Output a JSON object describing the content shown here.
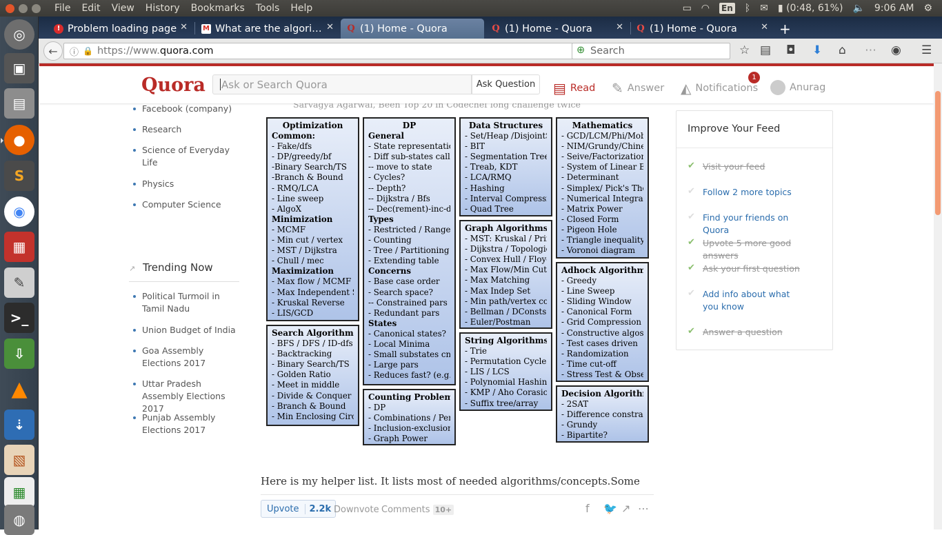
{
  "os_panel": {
    "menu": [
      "File",
      "Edit",
      "View",
      "History",
      "Bookmarks",
      "Tools",
      "Help"
    ],
    "keyboard": "En",
    "battery": "(0:48, 61%)",
    "time": "9:06 AM"
  },
  "tabs": [
    {
      "title": "Problem loading page",
      "icon": "error-icon"
    },
    {
      "title": "What are the algori…",
      "icon": "gmail-icon"
    },
    {
      "title": "(1) Home - Quora",
      "icon": "quora-icon"
    },
    {
      "title": "(1) Home - Quora",
      "icon": "quora-icon"
    },
    {
      "title": "(1) Home - Quora",
      "icon": "quora-icon"
    }
  ],
  "url": {
    "prefix": "https://www.",
    "domain": "quora.com"
  },
  "browser_search_placeholder": "Search",
  "quora": {
    "logo": "Quora",
    "search_placeholder": "Ask or Search Quora",
    "ask_button": "Ask Question",
    "nav": {
      "read": "Read",
      "answer": "Answer",
      "notifications": "Notifications",
      "notif_count": "1",
      "user": "Anurag"
    }
  },
  "sidebar": {
    "topics": [
      "Facebook (company)",
      "Research",
      "Science of Everyday Life",
      "Physics",
      "Computer Science"
    ],
    "trending_title": "Trending Now",
    "trending": [
      "Political Turmoil in Tamil Nadu",
      "Union Budget of India",
      "Goa Assembly Elections 2017",
      "Uttar Pradesh Assembly Elections 2017",
      "Punjab Assembly Elections 2017"
    ]
  },
  "answer": {
    "author_line": "Sarvagya Agarwal, Been Top 20 in Codechef long challenge twice",
    "helper_text": "Here is my helper list. It lists most of needed algorithms/concepts.Some",
    "upvote_label": "Upvote",
    "upvote_count": "2.2k",
    "downvote_label": "Downvote",
    "comments_label": "Comments",
    "comments_count": "10+"
  },
  "sheet": {
    "optimization": {
      "title": "Optimization",
      "lines": [
        [
          "s",
          "Common:"
        ],
        [
          "",
          "- Fake/dfs"
        ],
        [
          "",
          "- DP/greedy/bf"
        ],
        [
          "",
          "-Binary Search/TS"
        ],
        [
          "",
          "-Branch & Bound"
        ],
        [
          "",
          "- RMQ/LCA"
        ],
        [
          "",
          "- Line sweep"
        ],
        [
          "",
          "- AlgoX"
        ],
        [
          "s",
          "Minimization"
        ],
        [
          "",
          "- MCMF"
        ],
        [
          "",
          "- Min cut / vertex"
        ],
        [
          "",
          "- MST / Dijkstra"
        ],
        [
          "",
          "- Chull / mec"
        ],
        [
          "s",
          "Maximization"
        ],
        [
          "",
          "- Max flow / MCMF"
        ],
        [
          "",
          "- Max Independent Set"
        ],
        [
          "",
          "- Kruskal Reverse"
        ],
        [
          "",
          "- LIS/GCD"
        ]
      ]
    },
    "search": {
      "title": "Search Algorithms",
      "lines": [
        [
          "",
          "- BFS / DFS / ID-dfs"
        ],
        [
          "",
          "- Backtracking"
        ],
        [
          "",
          "- Binary Search/TS"
        ],
        [
          "",
          "- Golden Ratio"
        ],
        [
          "",
          "- Meet in middle"
        ],
        [
          "",
          "- Divide & Conquer"
        ],
        [
          "",
          "- Branch & Bound"
        ],
        [
          "",
          "- Min Enclosing Circle"
        ]
      ]
    },
    "dp": {
      "title": "DP",
      "lines": [
        [
          "s",
          "General"
        ],
        [
          "",
          "- State representation(s)"
        ],
        [
          "",
          "- Diff sub-states calls?"
        ],
        [
          "",
          "-- move to state"
        ],
        [
          "",
          "- Cycles?"
        ],
        [
          "",
          "-- Depth?"
        ],
        [
          "",
          "-- Dijkstra / Bfs"
        ],
        [
          "",
          "-- Dec(rement)-inc-dec"
        ],
        [
          "s",
          "Types"
        ],
        [
          "",
          "- Restricted / Range"
        ],
        [
          "",
          "- Counting"
        ],
        [
          "",
          "- Tree / Partitioning"
        ],
        [
          "",
          "-  Extending table"
        ],
        [
          "s",
          "Concerns"
        ],
        [
          "",
          "- Base case order"
        ],
        [
          "",
          "- Search space?"
        ],
        [
          "",
          "-- Constrained pars"
        ],
        [
          "",
          "- Redundant pars"
        ],
        [
          "s",
          "States"
        ],
        [
          "",
          "- Canonical states?"
        ],
        [
          "",
          "- Local Minima"
        ],
        [
          "",
          "- Small substates cnt?"
        ],
        [
          "",
          "- Large pars"
        ],
        [
          "",
          "- Reduces fast? (e.g. /)"
        ]
      ]
    },
    "counting": {
      "title": "Counting Problems",
      "lines": [
        [
          "",
          "- DP"
        ],
        [
          "",
          "- Combinations / Perms"
        ],
        [
          "",
          "- Inclusion-exclusion"
        ],
        [
          "",
          "- Graph Power"
        ]
      ]
    },
    "ds": {
      "title": "Data Structures",
      "lines": [
        [
          "",
          "- Set/Heap /DisjointSets"
        ],
        [
          "",
          "- BIT"
        ],
        [
          "",
          "- Segmentation Tree"
        ],
        [
          "",
          "- Treab, KDT"
        ],
        [
          "",
          "- LCA/RMQ"
        ],
        [
          "",
          "- Hashing"
        ],
        [
          "",
          "- Interval Compression"
        ],
        [
          "",
          "- Quad Tree"
        ]
      ]
    },
    "graph": {
      "title": "Graph Algorithms",
      "lines": [
        [
          "",
          "- MST: Kruskal / Prime"
        ],
        [
          "",
          "- Dijkstra / Topological"
        ],
        [
          "",
          "- Convex Hull / Floyd"
        ],
        [
          "",
          "- Max Flow/Min Cut"
        ],
        [
          "",
          "- Max Matching"
        ],
        [
          "",
          "- Max Indep Set"
        ],
        [
          "",
          "- Min path/vertex cover"
        ],
        [
          "",
          "- Bellman / DConsts"
        ],
        [
          "",
          "- Euler/Postman"
        ]
      ]
    },
    "string": {
      "title": "String Algorithms",
      "lines": [
        [
          "",
          "- Trie"
        ],
        [
          "",
          "- Permutation Cycles"
        ],
        [
          "",
          "- LIS / LCS"
        ],
        [
          "",
          "- Polynomial Hashing"
        ],
        [
          "",
          "- KMP / Aho Corasick"
        ],
        [
          "",
          "- Suffix tree/array"
        ]
      ]
    },
    "math": {
      "title": "Mathematics",
      "lines": [
        [
          "",
          "- GCD/LCM/Phi/Mob"
        ],
        [
          "",
          "- NIM/Grundy/Chinese"
        ],
        [
          "",
          "- Seive/Factorization"
        ],
        [
          "",
          "- System of Linear Eqs"
        ],
        [
          "",
          "- Determinant"
        ],
        [
          "",
          "- Simplex/ Pick's Theo"
        ],
        [
          "",
          "- Numerical Integration"
        ],
        [
          "",
          "- Matrix Power"
        ],
        [
          "",
          "- Closed Form"
        ],
        [
          "",
          "- Pigeon Hole"
        ],
        [
          "",
          "- Triangle inequality"
        ],
        [
          "",
          "- Voronoi diagram"
        ]
      ]
    },
    "adhock": {
      "title": "Adhock Algorithms",
      "lines": [
        [
          "",
          "- Greedy"
        ],
        [
          "",
          "- Line Sweep"
        ],
        [
          "",
          "- Sliding Window"
        ],
        [
          "",
          "- Canonical Form"
        ],
        [
          "",
          "- Grid Compression"
        ],
        [
          "",
          "- Constructive algos"
        ],
        [
          "",
          "- Test cases driven"
        ],
        [
          "",
          "- Randomization"
        ],
        [
          "",
          "- Time cut-off"
        ],
        [
          "",
          "- Stress Test & Observe"
        ]
      ]
    },
    "decision": {
      "title": "Decision Algorithms",
      "lines": [
        [
          "",
          "- 2SAT"
        ],
        [
          "",
          "- Difference constraints"
        ],
        [
          "",
          "- Grundy"
        ],
        [
          "",
          "- Bipartite?"
        ]
      ]
    }
  },
  "feed": {
    "title": "Improve Your Feed",
    "items": [
      {
        "text": "Visit your feed",
        "done": true
      },
      {
        "text": "Follow 2 more topics",
        "done": false
      },
      {
        "text": "Find your friends on Quora",
        "done": false
      },
      {
        "text": "Upvote 5 more good answers",
        "done": true
      },
      {
        "text": "Ask your first question",
        "done": true
      },
      {
        "text": "Add info about what you know",
        "done": false
      },
      {
        "text": "Answer a question",
        "done": true
      }
    ]
  }
}
